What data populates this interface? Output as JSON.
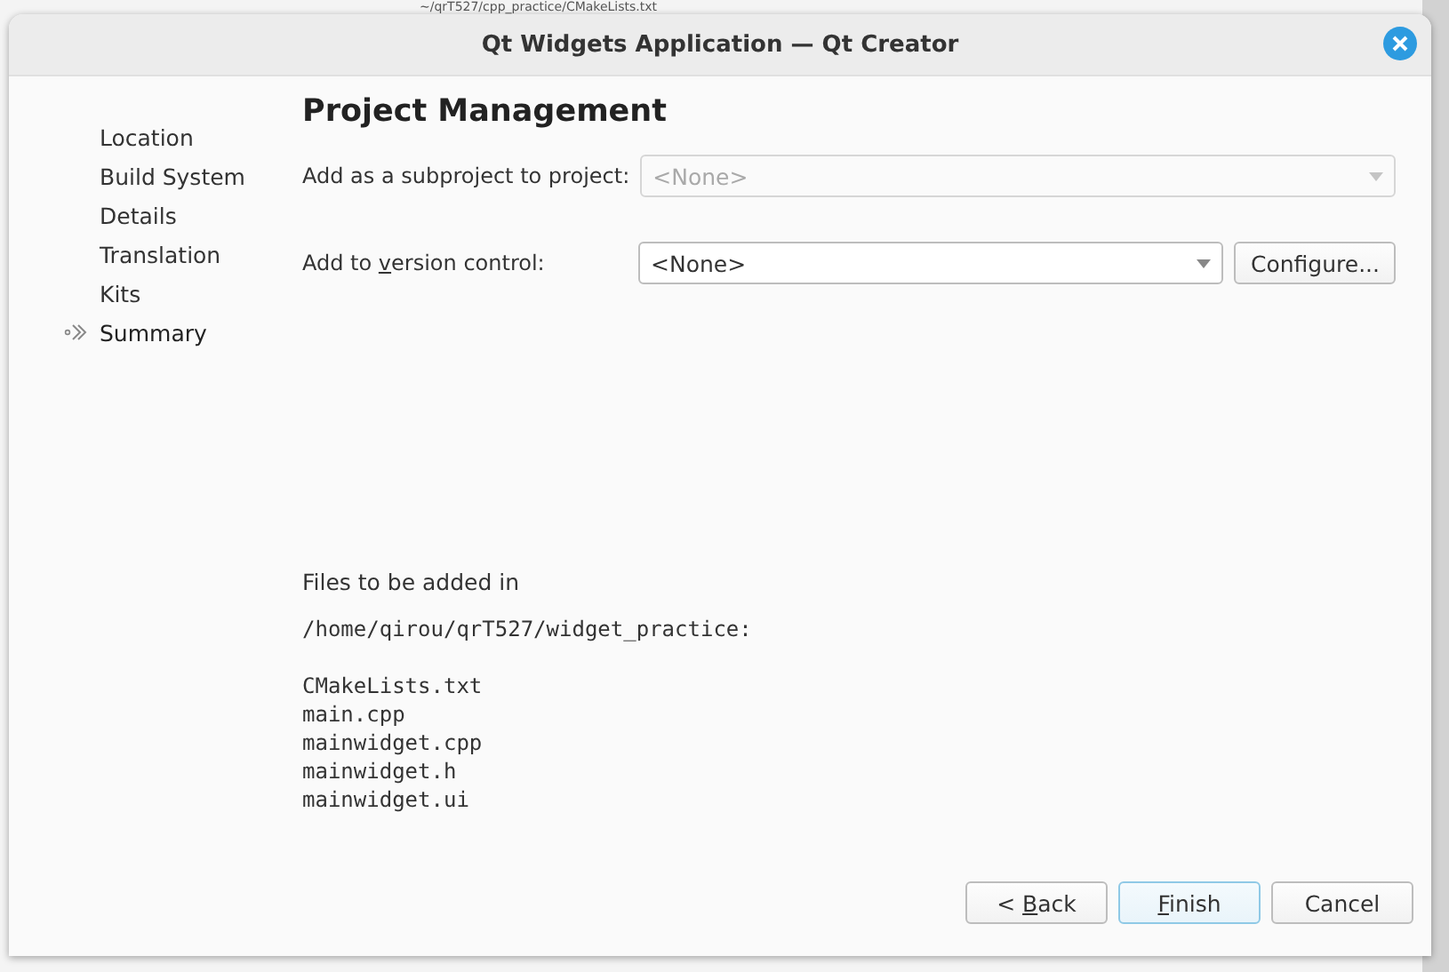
{
  "background": {
    "path_text": "~/qrT527/cpp_practice/CMakeLists.txt"
  },
  "window": {
    "title": "Qt Widgets Application — Qt Creator"
  },
  "sidebar": {
    "items": [
      {
        "label": "Location",
        "selected": false
      },
      {
        "label": "Build System",
        "selected": false
      },
      {
        "label": "Details",
        "selected": false
      },
      {
        "label": "Translation",
        "selected": false
      },
      {
        "label": "Kits",
        "selected": false
      },
      {
        "label": "Summary",
        "selected": true
      }
    ]
  },
  "page": {
    "title": "Project Management",
    "fields": [
      {
        "label": "Add as a subproject to project:",
        "value": "<None>",
        "disabled": true
      },
      {
        "label": "Add to ",
        "mnemonic": "v",
        "label_rest": "ersion control:",
        "value": "<None>",
        "disabled": false,
        "button": "Configure..."
      }
    ],
    "files_heading": "Files to be added in",
    "files_path": "/home/qirou/qrT527/widget_practice:",
    "files": [
      "CMakeLists.txt",
      "main.cpp",
      "mainwidget.cpp",
      "mainwidget.h",
      "mainwidget.ui"
    ]
  },
  "buttons": [
    {
      "label": "< ",
      "mnemonic": "B",
      "label_rest": "ack",
      "default": false
    },
    {
      "mnemonic": "F",
      "label_rest": "inish",
      "default": true
    },
    {
      "label": "Cancel",
      "default": false
    }
  ]
}
